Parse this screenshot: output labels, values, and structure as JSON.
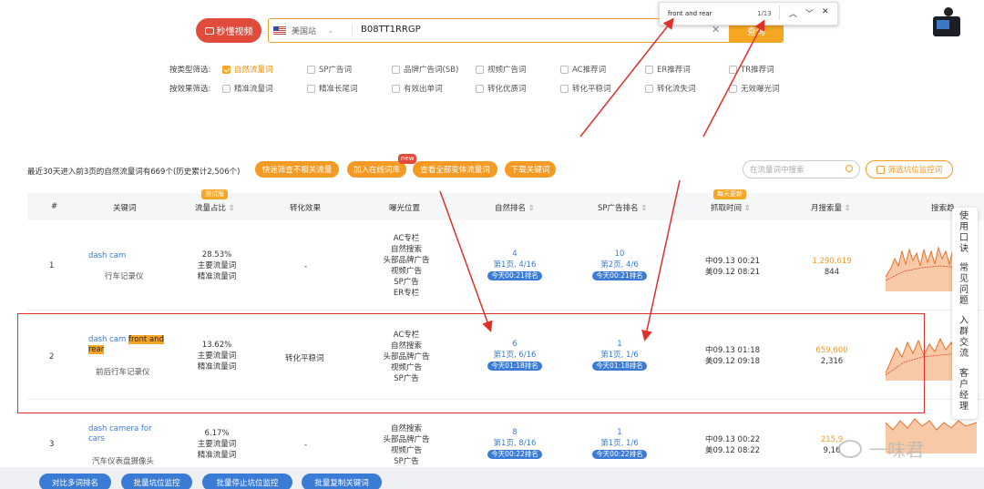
{
  "header": {
    "video_button": "秒懂视频",
    "site_label": "美国站",
    "asin": "B08TT1RRGP",
    "query_button": "查询"
  },
  "findbar": {
    "text": "front and rear",
    "count": "1/13"
  },
  "filters": {
    "type_label": "按类型筛选:",
    "type_options": [
      "自然流量词",
      "SP广告词",
      "品牌广告词(SB)",
      "视频广告词",
      "AC推荐词",
      "ER推荐词",
      "TR推荐词"
    ],
    "effect_label": "按效果筛选:",
    "effect_options": [
      "精准流量词",
      "精准长尾词",
      "有效出单词",
      "转化优质词",
      "转化平稳词",
      "转化流失词",
      "无效曝光词"
    ]
  },
  "summary": {
    "text": "最近30天进入前3页的自然流量词有669个(历史累计2,506个)",
    "buttons": [
      "快速筛查不相关流量",
      "加入在线词库",
      "查看全部变体流量词",
      "下载关键词"
    ],
    "new_tag": "new",
    "search_placeholder": "在流量词中搜索",
    "pit_button": "筛选坑位监控词"
  },
  "table": {
    "headers": {
      "num": "#",
      "keyword": "关键词",
      "traffic": "流量占比",
      "traffic_tag": "测试版",
      "conversion": "转化效果",
      "exposure": "曝光位置",
      "organic": "自然排名",
      "sp": "SP广告排名",
      "crawl": "抓取时间",
      "crawl_tag": "每天更新",
      "volume": "月搜索量",
      "trend": "搜索趋"
    },
    "rows": [
      {
        "num": "1",
        "kw_pre": "dash cam",
        "kw_hl": "",
        "kw_post": "",
        "cn": "行车记录仪",
        "traffic_pct": "28.53%",
        "traffic_l1": "主要流量词",
        "traffic_l2": "精准流量词",
        "conversion": "-",
        "exposure": [
          "AC专栏",
          "自然搜索",
          "头部品牌广告",
          "视频广告",
          "SP广告",
          "ER专栏"
        ],
        "org_rank": "4",
        "org_page": "第1页, 4/16",
        "org_pill": "今天00:21排名",
        "sp_rank": "10",
        "sp_page": "第2页, 4/6",
        "sp_pill": "今天00:21排名",
        "crawl_cn": "中09.13 00:21",
        "crawl_us": "美09.12 08:21",
        "vol_main": "1,290,619",
        "vol_sub": "844"
      },
      {
        "num": "2",
        "kw_pre": "dash cam ",
        "kw_hl": "front and rear",
        "kw_post": "",
        "cn": "前后行车记录仪",
        "traffic_pct": "13.62%",
        "traffic_l1": "主要流量词",
        "traffic_l2": "精准流量词",
        "conversion": "转化平稳词",
        "exposure": [
          "AC专栏",
          "自然搜索",
          "头部品牌广告",
          "视频广告",
          "SP广告"
        ],
        "org_rank": "6",
        "org_page": "第1页, 6/16",
        "org_pill": "今天01:18排名",
        "sp_rank": "1",
        "sp_page": "第1页, 1/6",
        "sp_pill": "今天01:18排名",
        "crawl_cn": "中09.13 01:18",
        "crawl_us": "美09.12 09:18",
        "vol_main": "659,600",
        "vol_sub": "2,316"
      },
      {
        "num": "3",
        "kw_pre": "dash camera for cars",
        "kw_hl": "",
        "kw_post": "",
        "cn": "汽车仪表盘摄像头",
        "traffic_pct": "6.17%",
        "traffic_l1": "主要流量词",
        "traffic_l2": "精准流量词",
        "conversion": "-",
        "exposure": [
          "自然搜索",
          "头部品牌广告",
          "视频广告",
          "SP广告"
        ],
        "org_rank": "8",
        "org_page": "第1页, 8/16",
        "org_pill": "今天00:22排名",
        "sp_rank": "1",
        "sp_page": "第1页, 1/6",
        "sp_pill": "今天00:22排名",
        "crawl_cn": "中09.13 00:22",
        "crawl_us": "美09.12 08:22",
        "vol_main": "215,9",
        "vol_sub": "9,16"
      }
    ]
  },
  "side_panel": [
    "使用口诀",
    "常见问题",
    "入群交流",
    "客户经理"
  ],
  "bottom_buttons": [
    "对比多词排名",
    "批量坑位监控",
    "批量停止坑位监控",
    "批量复制关键词"
  ],
  "watermark": "一味君",
  "colors": {
    "accent_orange": "#f59a23",
    "link_blue": "#3a7bd5",
    "highlight_red": "#e0302a"
  }
}
